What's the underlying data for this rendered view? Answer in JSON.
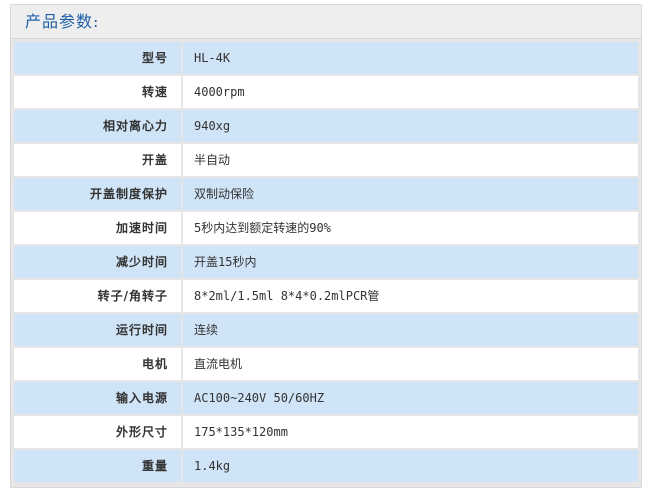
{
  "header": {
    "title": "产品参数:"
  },
  "specs": [
    {
      "label": "型号",
      "value": "HL-4K"
    },
    {
      "label": "转速",
      "value": "4000rpm"
    },
    {
      "label": "相对离心力",
      "value": "940xg"
    },
    {
      "label": "开盖",
      "value": "半自动"
    },
    {
      "label": "开盖制度保护",
      "value": "双制动保险"
    },
    {
      "label": "加速时间",
      "value": "5秒内达到额定转速的90%"
    },
    {
      "label": "减少时间",
      "value": "开盖15秒内"
    },
    {
      "label": "转子/角转子",
      "value": "8*2ml/1.5ml 8*4*0.2mlPCR管"
    },
    {
      "label": "运行时间",
      "value": "连续"
    },
    {
      "label": "电机",
      "value": "直流电机"
    },
    {
      "label": "输入电源",
      "value": "AC100~240V 50/60HZ"
    },
    {
      "label": "外形尺寸",
      "value": "175*135*120mm"
    },
    {
      "label": "重量",
      "value": "1.4kg"
    }
  ],
  "colors": {
    "row_alt_background": "#cfe4f7",
    "row_background": "#ffffff",
    "title_color": "#1f5fa8"
  }
}
